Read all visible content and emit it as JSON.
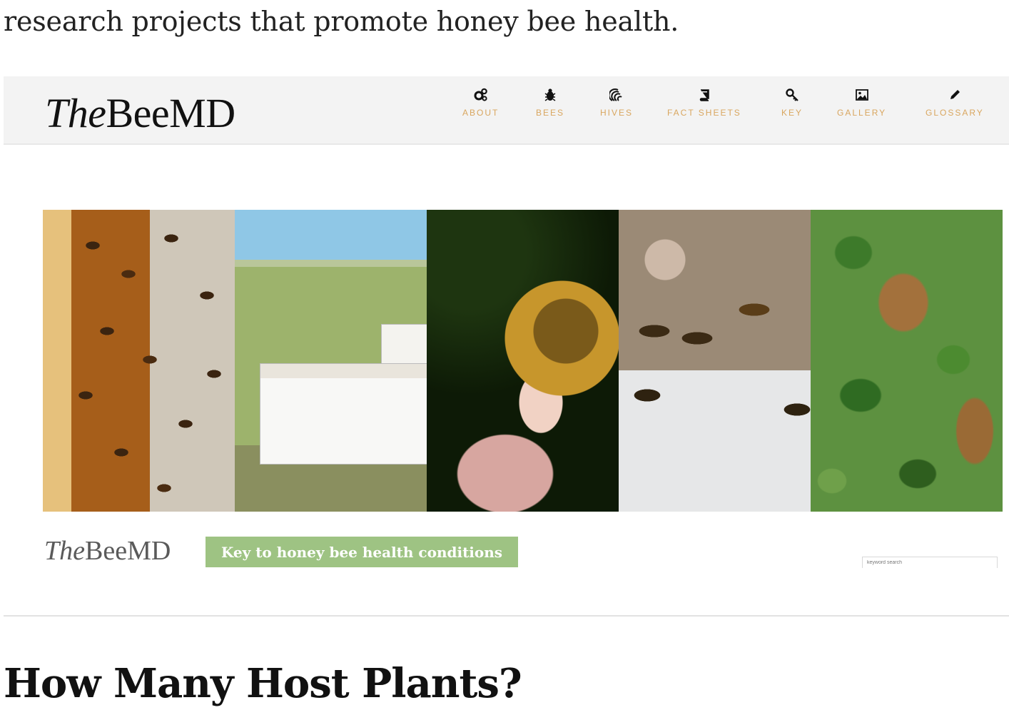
{
  "intro_text": "research projects that promote honey bee health.",
  "site": {
    "logo_prefix": "The",
    "logo_suffix": "BeeMD",
    "nav": [
      {
        "label": "ABOUT",
        "icon": "cogs-icon"
      },
      {
        "label": "BEES",
        "icon": "bug-icon"
      },
      {
        "label": "HIVES",
        "icon": "hive-icon"
      },
      {
        "label": "FACT SHEETS",
        "icon": "book-icon"
      },
      {
        "label": "KEY",
        "icon": "key-icon"
      },
      {
        "label": "GALLERY",
        "icon": "picture-icon"
      },
      {
        "label": "GLOSSARY",
        "icon": "pencil-icon"
      }
    ],
    "accent_color": "#d9a65f",
    "banner_panels": [
      "bees-on-comb",
      "hives-in-field",
      "bee-on-flower",
      "bees-at-hive-entrance",
      "swarm-in-holly"
    ],
    "logo_small_prefix": "The",
    "logo_small_suffix": "BeeMD",
    "key_button": "Key to honey bee health conditions",
    "key_button_color": "#9ec383",
    "search_placeholder": "keyword search"
  },
  "heading": "How Many Host Plants?"
}
